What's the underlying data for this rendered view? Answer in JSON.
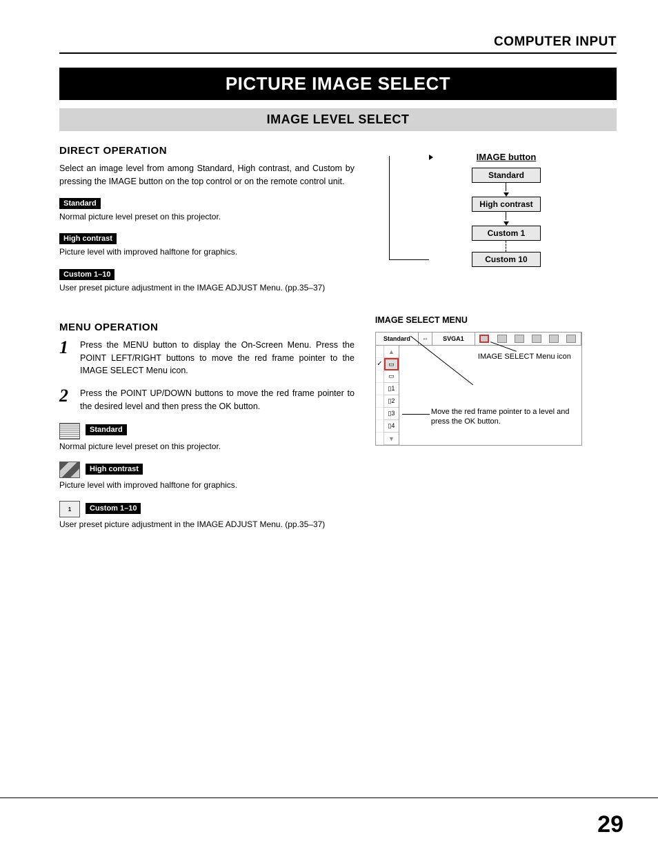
{
  "header_label": "COMPUTER INPUT",
  "title": "PICTURE IMAGE SELECT",
  "subtitle": "IMAGE LEVEL SELECT",
  "direct_op": {
    "heading": "DIRECT OPERATION",
    "intro": "Select an image level from among Standard, High contrast, and Custom by pressing the IMAGE button on the top control or on the remote control unit.",
    "items": [
      {
        "tag": "Standard",
        "desc": "Normal picture level preset on this projector."
      },
      {
        "tag": "High contrast",
        "desc": "Picture level with improved halftone for graphics."
      },
      {
        "tag": "Custom 1–10",
        "desc": "User preset picture adjustment in the IMAGE ADJUST Menu. (pp.35–37)"
      }
    ]
  },
  "flow": {
    "title": "IMAGE button",
    "boxes": [
      "Standard",
      "High contrast",
      "Custom 1",
      "Custom 10"
    ]
  },
  "menu_op": {
    "heading": "MENU OPERATION",
    "steps": [
      {
        "num": "1",
        "text": "Press the MENU button to display the On-Screen Menu. Press the POINT LEFT/RIGHT buttons to move the red frame pointer to the IMAGE SELECT Menu icon."
      },
      {
        "num": "2",
        "text": "Press the POINT UP/DOWN buttons to move the red frame pointer to the desired level and then press the OK button."
      }
    ],
    "items": [
      {
        "tag": "Standard",
        "desc": "Normal picture level preset on this projector."
      },
      {
        "tag": "High contrast",
        "desc": "Picture level with improved halftone for graphics."
      },
      {
        "tag": "Custom 1–10",
        "desc": "User preset picture adjustment in the IMAGE ADJUST Menu. (pp.35–37)"
      }
    ]
  },
  "menu_panel": {
    "heading": "IMAGE SELECT MENU",
    "top_left": "Standard",
    "top_mid": "SVGA1",
    "annot1": "IMAGE SELECT Menu icon",
    "annot2": "Move the red frame pointer to a level and press the OK button."
  },
  "page_number": "29"
}
